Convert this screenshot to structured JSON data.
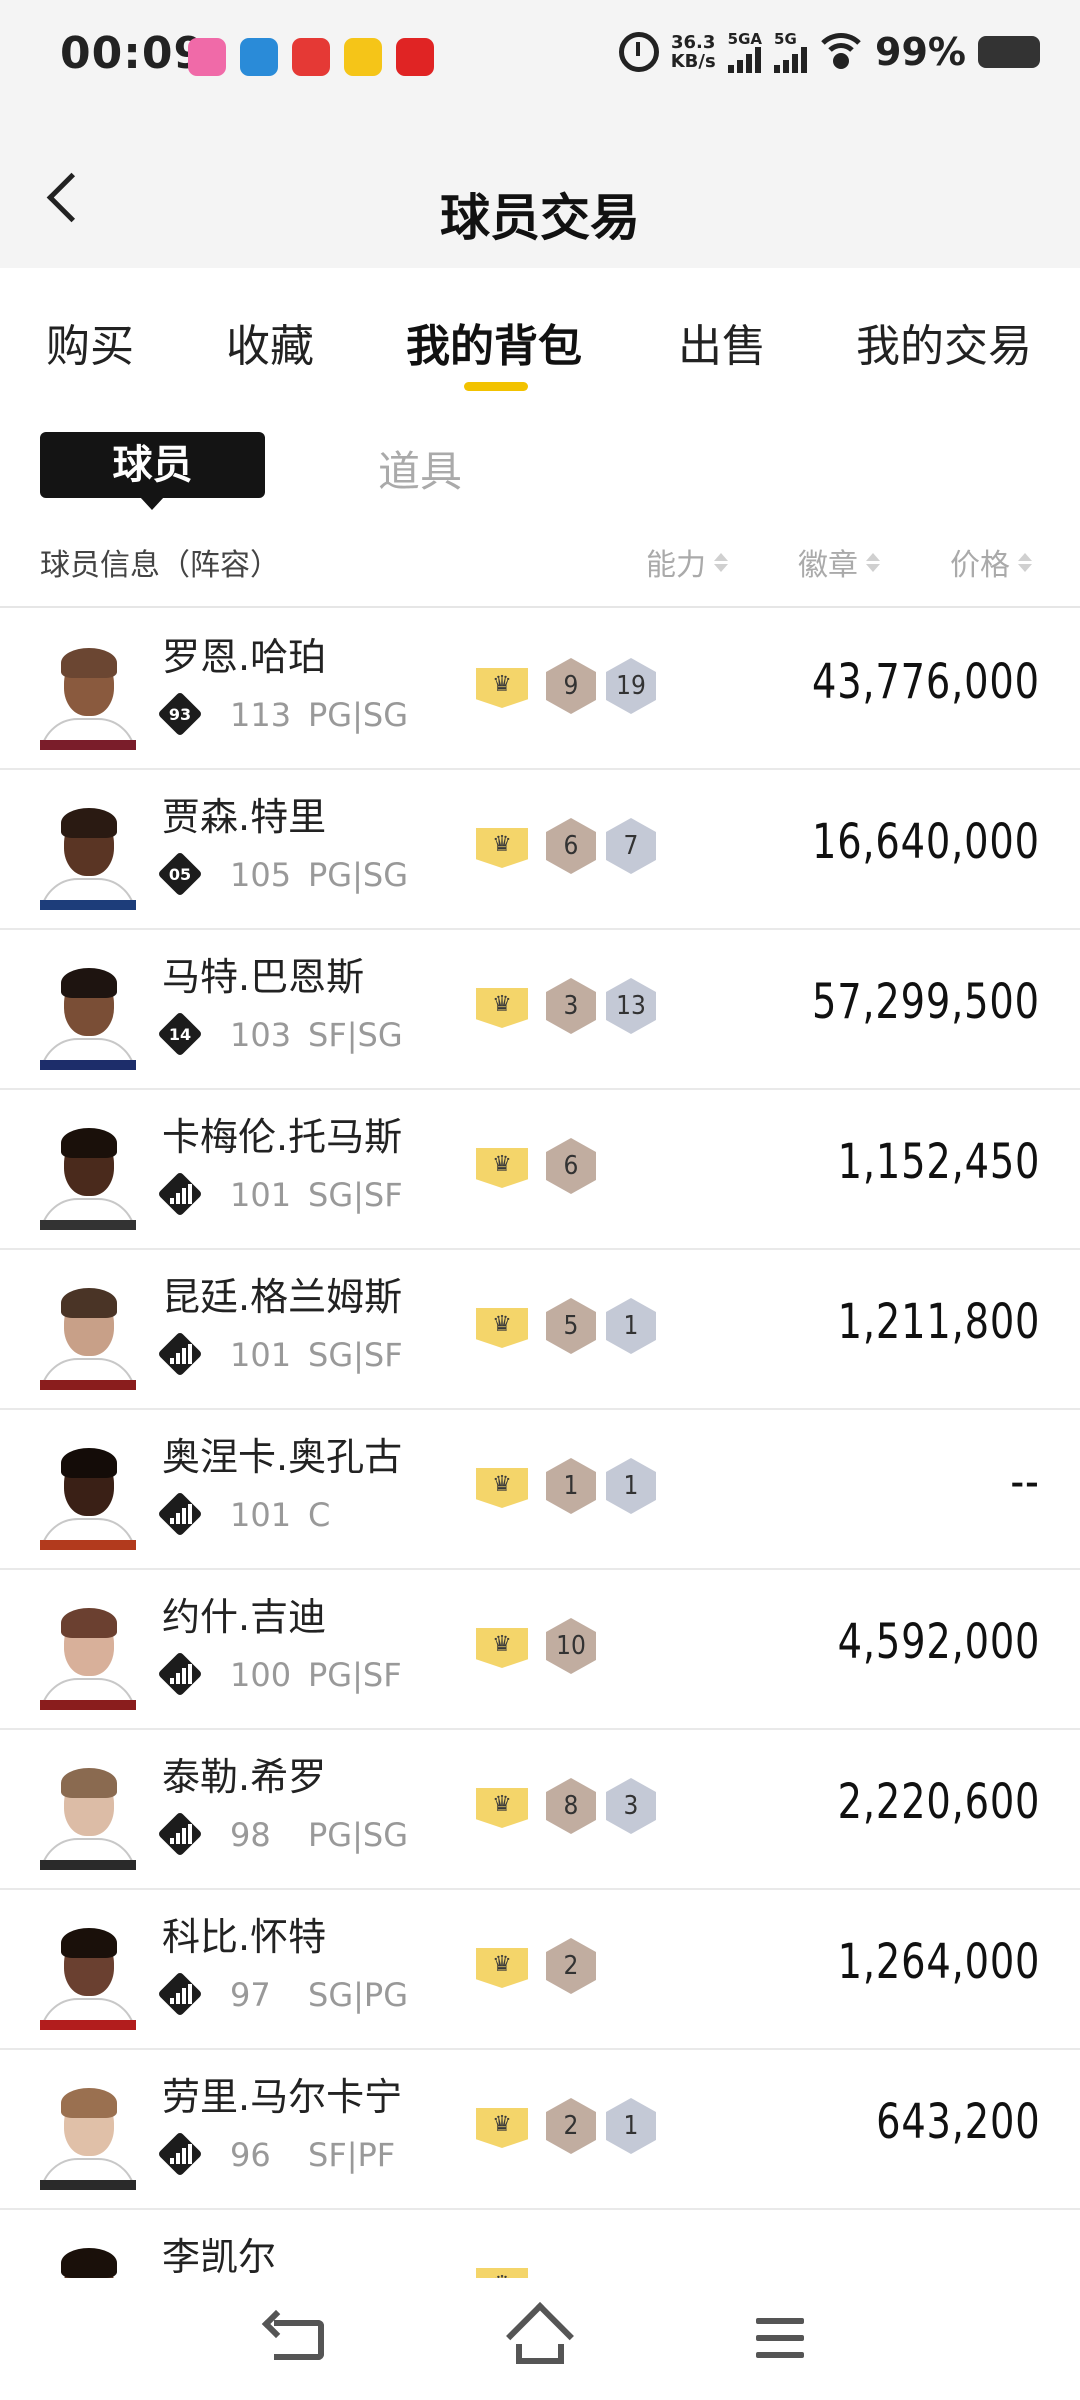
{
  "status_bar": {
    "time": "00:09",
    "net_speed_value": "36.3",
    "net_speed_unit": "KB/s",
    "signal1_label": "5GA",
    "signal2_label": "5G",
    "battery": "99%",
    "app_icon_colors": [
      "#f06aa8",
      "#2a8bd8",
      "#e53935",
      "#f5c518",
      "#e02424"
    ]
  },
  "header": {
    "title": "球员交易"
  },
  "tabs": [
    {
      "label": "购买"
    },
    {
      "label": "收藏"
    },
    {
      "label": "我的背包"
    },
    {
      "label": "出售"
    },
    {
      "label": "我的交易"
    }
  ],
  "subtabs": {
    "active": "球员",
    "other": "道具"
  },
  "list_header": {
    "info": "球员信息（阵容）",
    "ability": "能力",
    "badges": "徽章",
    "price": "价格"
  },
  "colors": {
    "accent": "#f2c200",
    "crown": "#f4d56a",
    "bronze": "#c1ada0",
    "silver": "#c4c9d6"
  },
  "players": [
    {
      "name": "罗恩.哈珀",
      "badge": "93",
      "rating": "113",
      "position": "PG|SG",
      "badge_bronze": "9",
      "badge_silver": "19",
      "price": "43,776,000",
      "skin": "#8a5a3e",
      "hair": "#6b4632",
      "trim": "#7a1d2a"
    },
    {
      "name": "贾森.特里",
      "badge": "05",
      "rating": "105",
      "position": "PG|SG",
      "badge_bronze": "6",
      "badge_silver": "7",
      "price": "16,640,000",
      "skin": "#5a3524",
      "hair": "#2a1a12",
      "trim": "#1d3d7a"
    },
    {
      "name": "马特.巴恩斯",
      "badge": "14",
      "rating": "103",
      "position": "SF|SG",
      "badge_bronze": "3",
      "badge_silver": "13",
      "price": "57,299,500",
      "skin": "#7a4e36",
      "hair": "#1e1410",
      "trim": "#1d2d6a"
    },
    {
      "name": "卡梅伦.托马斯",
      "badge": "",
      "rating": "101",
      "position": "SG|SF",
      "badge_bronze": "6",
      "badge_silver": "",
      "price": "1,152,450",
      "skin": "#4a2a1c",
      "hair": "#1a100a",
      "trim": "#333333"
    },
    {
      "name": "昆廷.格兰姆斯",
      "badge": "",
      "rating": "101",
      "position": "SG|SF",
      "badge_bronze": "5",
      "badge_silver": "1",
      "price": "1,211,800",
      "skin": "#c8a088",
      "hair": "#4a3426",
      "trim": "#8a1d1d"
    },
    {
      "name": "奥涅卡.奥孔古",
      "badge": "",
      "rating": "101",
      "position": "C",
      "badge_bronze": "1",
      "badge_silver": "1",
      "price": "--",
      "skin": "#3a2016",
      "hair": "#140c08",
      "trim": "#b23a1d"
    },
    {
      "name": "约什.吉迪",
      "badge": "",
      "rating": "100",
      "position": "PG|SF",
      "badge_bronze": "10",
      "badge_silver": "",
      "price": "4,592,000",
      "skin": "#d8b09a",
      "hair": "#6b4030",
      "trim": "#8a1d1d"
    },
    {
      "name": "泰勒.希罗",
      "badge": "",
      "rating": "98",
      "position": "PG|SG",
      "badge_bronze": "8",
      "badge_silver": "3",
      "price": "2,220,600",
      "skin": "#dcbca6",
      "hair": "#8a6a50",
      "trim": "#2a2a2a"
    },
    {
      "name": "科比.怀特",
      "badge": "",
      "rating": "97",
      "position": "SG|PG",
      "badge_bronze": "2",
      "badge_silver": "",
      "price": "1,264,000",
      "skin": "#6a4030",
      "hair": "#1a100a",
      "trim": "#b21d1d"
    },
    {
      "name": "劳里.马尔卡宁",
      "badge": "",
      "rating": "96",
      "position": "SF|PF",
      "badge_bronze": "2",
      "badge_silver": "1",
      "price": "643,200",
      "skin": "#e0c0a8",
      "hair": "#9a7050",
      "trim": "#2a2a2a"
    },
    {
      "name": "李凯尔",
      "badge": "",
      "rating": "",
      "position": "",
      "badge_bronze": "",
      "badge_silver": "",
      "price": "",
      "skin": "#5a3524",
      "hair": "#1a100a",
      "trim": "#8a1d1d"
    }
  ]
}
